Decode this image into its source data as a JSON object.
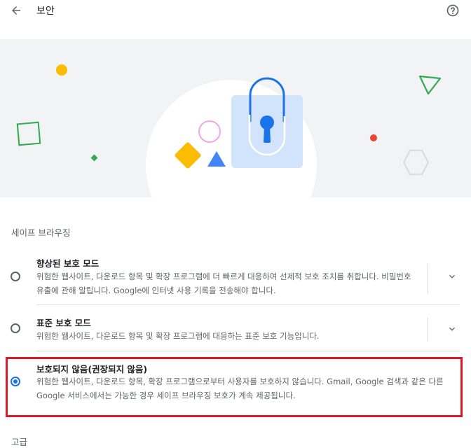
{
  "header": {
    "title": "보안",
    "back_icon": "arrow-back-icon",
    "help_icon": "help-circle-icon"
  },
  "hero": {
    "illustration": "lock-illustration"
  },
  "safe_browsing": {
    "section_title": "세이프 브라우징",
    "options": [
      {
        "title": "향상된 보호 모드",
        "description": "위험한 웹사이트, 다운로드 항목 및 확장 프로그램에 더 빠르게 대응하여 선제적 보호 조치를 취합니다. 비밀번호 유출에 관해 알립니다. Google에 인터넷 사용 기록을 전송해야 합니다.",
        "selected": false,
        "expand_icon": "chevron-down-icon"
      },
      {
        "title": "표준 보호 모드",
        "description": "위험한 웹사이트, 다운로드 항목 및 확장 프로그램에 대응하는 표준 보호 기능입니다.",
        "selected": false,
        "expand_icon": "chevron-down-icon"
      },
      {
        "title": "보호되지 않음(권장되지 않음)",
        "description": "위험한 웹사이트, 다운로드 항목, 확장 프로그램으로부터 사용자를 보호하지 않습니다. Gmail, Google 검색과 같은 다른 Google 서비스에서는 가능한 경우 세이프 브라우징 보호가 계속 제공됩니다.",
        "selected": true
      }
    ]
  },
  "advanced": {
    "title": "고급"
  },
  "colors": {
    "accent": "#1a73e8",
    "highlight": "#d81b28",
    "hero_bg": "#f1f3f4"
  }
}
